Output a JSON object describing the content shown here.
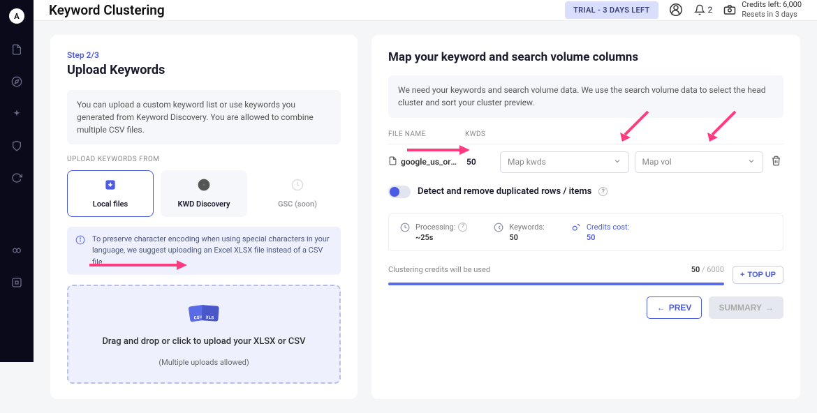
{
  "header": {
    "page_title": "Keyword Clustering",
    "trial_badge": "TRIAL - 3 DAYS LEFT",
    "notif_count": "2",
    "credits_line1": "Credits left: 6,000",
    "credits_line2": "Resets in 3 days"
  },
  "left": {
    "step": "Step 2/3",
    "title": "Upload Keywords",
    "intro": "You can upload a custom keyword list or use keywords you generated from Keyword Discovery. You are allowed to combine multiple CSV files.",
    "upload_from_label": "UPLOAD KEYWORDS FROM",
    "tabs": {
      "local": "Local files",
      "discovery": "KWD Discovery",
      "gsc": "GSC (soon)"
    },
    "encoding_note": "To preserve character encoding when using special characters in your language, we suggest uploading an Excel XLSX file instead of a CSV file.",
    "dropzone_text": "Drag and drop or click to upload your XLSX or CSV",
    "dropzone_sub": "(Multiple uploads allowed)"
  },
  "right": {
    "title": "Map your keyword and search volume columns",
    "info": "We need your keywords and search volume data. We use the search volume data to select the head cluster and sort your cluster preview.",
    "col_filename": "FILE NAME",
    "col_kwds": "KWDS",
    "file": {
      "name": "google_us_orga...",
      "kwds": "50"
    },
    "select_kwds_placeholder": "Map kwds",
    "select_vol_placeholder": "Map vol",
    "toggle_label": "Detect and remove duplicated rows / items",
    "stats": {
      "processing_label": "Processing:",
      "processing_value": "~25s",
      "keywords_label": "Keywords:",
      "keywords_value": "50",
      "credits_label": "Credits cost:",
      "credits_value": "50"
    },
    "credits_bar_label": "Clustering credits will be used",
    "credits_bar_value": "50",
    "credits_bar_sep": " / ",
    "credits_bar_total": "6000",
    "topup": "TOP UP",
    "prev": "PREV",
    "summary": "SUMMARY"
  }
}
